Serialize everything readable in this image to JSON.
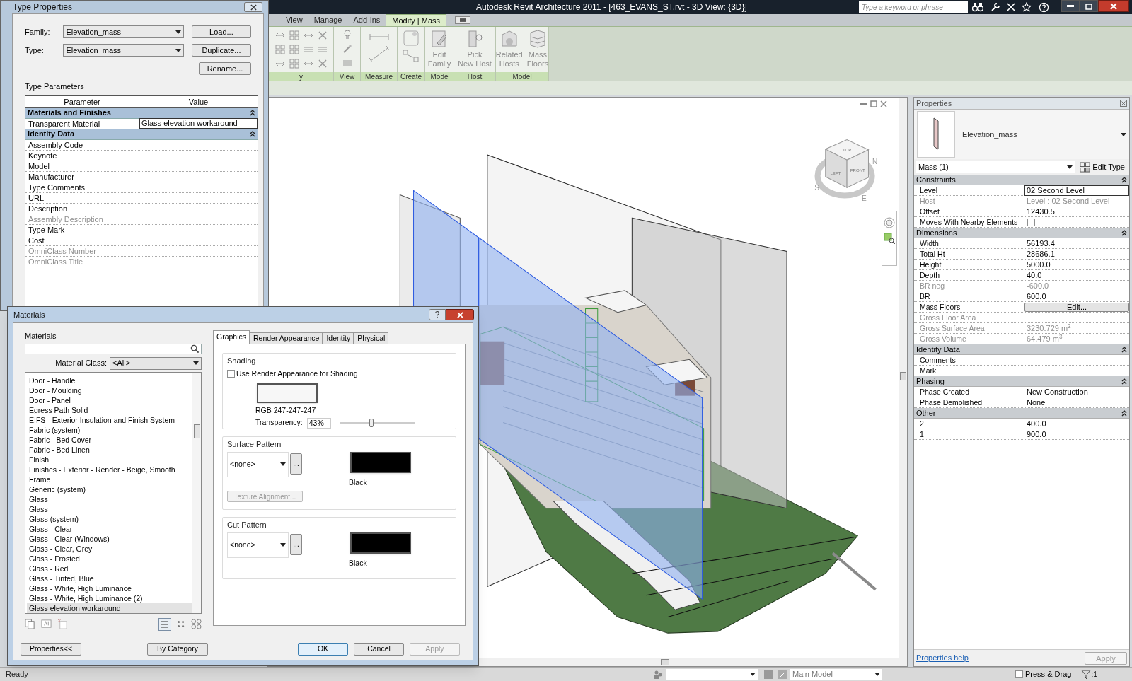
{
  "window": {
    "title": "Autodesk Revit Architecture 2011 - [463_EVANS_ST.rvt - 3D View: {3D}]"
  },
  "search": {
    "placeholder": "Type a keyword or phrase"
  },
  "ribbon_tabs": [
    {
      "label": "View",
      "selected": false
    },
    {
      "label": "Manage",
      "selected": false
    },
    {
      "label": "Add-Ins",
      "selected": false
    },
    {
      "label": "Modify | Mass",
      "selected": true
    }
  ],
  "ribbon_panels": [
    {
      "label": "y",
      "kind": "modify_tools"
    },
    {
      "label": "View",
      "kind": "view_tools"
    },
    {
      "label": "Measure",
      "kind": "measure_tools"
    },
    {
      "label": "Create",
      "kind": "create_tools"
    },
    {
      "label": "Mode",
      "kind": "large",
      "buttons": [
        {
          "label": "Edit Family",
          "disabled": true
        }
      ]
    },
    {
      "label": "Host",
      "kind": "large",
      "buttons": [
        {
          "label": "Pick New Host",
          "disabled": true
        }
      ]
    },
    {
      "label": "Model",
      "kind": "large",
      "buttons": [
        {
          "label": "Related Hosts",
          "disabled": true
        },
        {
          "label": "Mass Floors",
          "disabled": true
        }
      ]
    }
  ],
  "view_cube": {
    "faces": [
      "TOP",
      "LEFT",
      "FRONT"
    ],
    "compass": [
      "N",
      "E",
      "S"
    ]
  },
  "properties": {
    "title": "Properties",
    "type_name": "Elevation_mass",
    "selector": "Mass (1)",
    "edit_type": "Edit Type",
    "groups": [
      {
        "label": "Constraints",
        "expanded": true,
        "rows": [
          {
            "name": "Level",
            "value": "02 Second Level",
            "kind": "field",
            "disabled": false
          },
          {
            "name": "Host",
            "value": "Level : 02 Second Level",
            "kind": "text",
            "disabled": true
          },
          {
            "name": "Offset",
            "value": "12430.5",
            "kind": "text",
            "disabled": false
          },
          {
            "name": "Moves With Nearby Elements",
            "kind": "checkbox",
            "checked": false,
            "disabled": false
          }
        ]
      },
      {
        "label": "Dimensions",
        "expanded": true,
        "rows": [
          {
            "name": "Width",
            "value": "56193.4",
            "kind": "text",
            "disabled": false
          },
          {
            "name": "Total Ht",
            "value": "28686.1",
            "kind": "text",
            "disabled": false
          },
          {
            "name": "Height",
            "value": "5000.0",
            "kind": "text",
            "disabled": false
          },
          {
            "name": "Depth",
            "value": "40.0",
            "kind": "text",
            "disabled": false
          },
          {
            "name": "BR neg",
            "value": "-600.0",
            "kind": "text",
            "disabled": true
          },
          {
            "name": "BR",
            "value": "600.0",
            "kind": "text",
            "disabled": false
          },
          {
            "name": "Mass Floors",
            "value": "Edit...",
            "kind": "button",
            "disabled": false
          },
          {
            "name": "Gross Floor Area",
            "kind": "text",
            "disabled": true
          },
          {
            "name": "Gross Surface Area",
            "value": "3230.729 m$^{2}$",
            "kind": "text",
            "disabled": true
          },
          {
            "name": "Gross Volume",
            "value": "64.479 m$^{3}$",
            "kind": "text",
            "disabled": true
          }
        ]
      },
      {
        "label": "Identity Data",
        "expanded": true,
        "rows": [
          {
            "name": "Comments",
            "kind": "text",
            "disabled": false
          },
          {
            "name": "Mark",
            "kind": "text",
            "disabled": false
          }
        ]
      },
      {
        "label": "Phasing",
        "expanded": true,
        "rows": [
          {
            "name": "Phase Created",
            "value": "New Construction",
            "kind": "text",
            "disabled": false
          },
          {
            "name": "Phase Demolished",
            "value": "None",
            "kind": "text",
            "disabled": false
          }
        ]
      },
      {
        "label": "Other",
        "expanded": true,
        "rows": [
          {
            "name": "2",
            "value": "400.0",
            "kind": "text",
            "disabled": false
          },
          {
            "name": "1",
            "value": "900.0",
            "kind": "text",
            "disabled": false
          }
        ]
      }
    ],
    "help_link": "Properties help",
    "apply": {
      "label": "Apply",
      "disabled": true
    }
  },
  "status_bar": {
    "text": "Ready",
    "model": "Main Model",
    "press_drag": {
      "label": "Press & Drag",
      "checked": false
    },
    "filter_count": ":1"
  },
  "type_properties": {
    "title": "Type Properties",
    "family": {
      "label": "Family:",
      "value": "Elevation_mass"
    },
    "type": {
      "label": "Type:",
      "value": "Elevation_mass"
    },
    "buttons": [
      "Load...",
      "Duplicate...",
      "Rename..."
    ],
    "section": "Type Parameters",
    "columns": [
      "Parameter",
      "Value"
    ],
    "groups": [
      {
        "label": "Materials and Finishes",
        "expanded": true,
        "rows": [
          {
            "name": "Transparent Material",
            "value": "Glass elevation workaround",
            "kind": "field",
            "disabled": false
          }
        ]
      },
      {
        "label": "Identity Data",
        "expanded": true,
        "rows": [
          {
            "name": "Assembly Code",
            "kind": "text",
            "disabled": false
          },
          {
            "name": "Keynote",
            "kind": "text",
            "disabled": false
          },
          {
            "name": "Model",
            "kind": "text",
            "disabled": false
          },
          {
            "name": "Manufacturer",
            "kind": "text",
            "disabled": false
          },
          {
            "name": "Type Comments",
            "kind": "text",
            "disabled": false
          },
          {
            "name": "URL",
            "kind": "text",
            "disabled": false
          },
          {
            "name": "Description",
            "kind": "text",
            "disabled": false
          },
          {
            "name": "Assembly Description",
            "kind": "text",
            "disabled": true
          },
          {
            "name": "Type Mark",
            "kind": "text",
            "disabled": false
          },
          {
            "name": "Cost",
            "kind": "text",
            "disabled": false
          },
          {
            "name": "OmniClass Number",
            "kind": "text",
            "disabled": true
          },
          {
            "name": "OmniClass Title",
            "kind": "text",
            "disabled": true
          }
        ]
      }
    ]
  },
  "materials": {
    "title": "Materials",
    "list_label": "Materials",
    "class_label": "Material Class:",
    "class_value": "<All>",
    "items": [
      {
        "label": "Door - Handle",
        "selected": false
      },
      {
        "label": "Door - Moulding",
        "selected": false
      },
      {
        "label": "Door - Panel",
        "selected": false
      },
      {
        "label": "Egress Path Solid",
        "selected": false
      },
      {
        "label": "EIFS - Exterior Insulation and Finish System",
        "selected": false
      },
      {
        "label": "Fabric (system)",
        "selected": false
      },
      {
        "label": "Fabric - Bed Cover",
        "selected": false
      },
      {
        "label": "Fabric - Bed Linen",
        "selected": false
      },
      {
        "label": "Finish",
        "selected": false
      },
      {
        "label": "Finishes - Exterior - Render - Beige, Smooth",
        "selected": false
      },
      {
        "label": "Frame",
        "selected": false
      },
      {
        "label": "Generic (system)",
        "selected": false
      },
      {
        "label": "Glass",
        "selected": false
      },
      {
        "label": "Glass",
        "selected": false
      },
      {
        "label": "Glass (system)",
        "selected": false
      },
      {
        "label": "Glass - Clear",
        "selected": false
      },
      {
        "label": "Glass - Clear (Windows)",
        "selected": false
      },
      {
        "label": "Glass - Clear, Grey",
        "selected": false
      },
      {
        "label": "Glass - Frosted",
        "selected": false
      },
      {
        "label": "Glass - Red",
        "selected": false
      },
      {
        "label": "Glass - Tinted, Blue",
        "selected": false
      },
      {
        "label": "Glass - White, High Luminance",
        "selected": false
      },
      {
        "label": "Glass - White, High Luminance (2)",
        "selected": false
      },
      {
        "label": "Glass elevation workaround",
        "selected": true
      }
    ],
    "left_buttons": [
      "Properties<<",
      "By Category"
    ],
    "tabs": [
      {
        "label": "Graphics",
        "selected": true
      },
      {
        "label": "Render Appearance",
        "selected": false
      },
      {
        "label": "Identity",
        "selected": false
      },
      {
        "label": "Physical",
        "selected": false
      }
    ],
    "shading": {
      "label": "Shading",
      "checkbox": {
        "label": "Use Render Appearance for Shading",
        "checked": false
      },
      "color": "#f7f7f7",
      "rgb": "RGB 247-247-247",
      "transparency_label": "Transparency:",
      "transparency": "43%",
      "level": 0.43
    },
    "surface": {
      "label": "Surface Pattern",
      "pattern": "<none>",
      "more": "...",
      "color": "#000000",
      "color_name": "Black",
      "texture_button": {
        "label": "Texture Alignment...",
        "disabled": true
      }
    },
    "cut": {
      "label": "Cut Pattern",
      "pattern": "<none>",
      "more": "...",
      "color": "#000000",
      "color_name": "Black"
    },
    "actions": [
      {
        "label": "OK",
        "kind": "default"
      },
      {
        "label": "Cancel",
        "kind": "normal"
      },
      {
        "label": "Apply",
        "kind": "disabled"
      }
    ]
  }
}
